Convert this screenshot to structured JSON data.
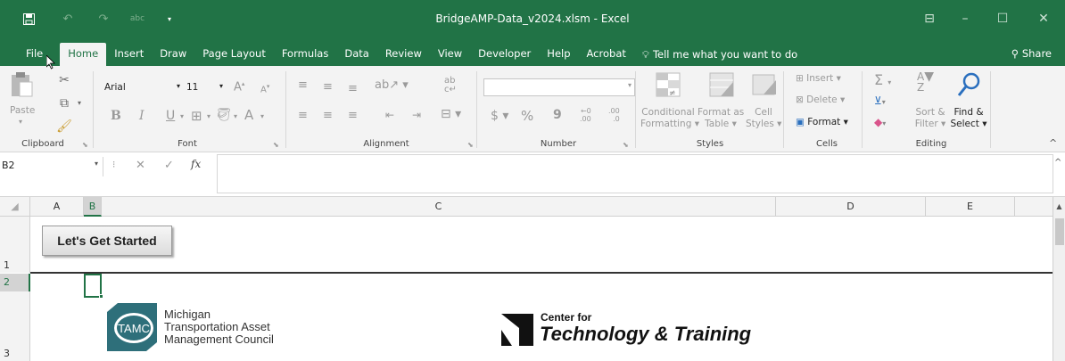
{
  "window": {
    "title": "BridgeAMP-Data_v2024.xlsm  -  Excel",
    "abc_label": "abc"
  },
  "tabs": [
    "File",
    "Home",
    "Insert",
    "Draw",
    "Page Layout",
    "Formulas",
    "Data",
    "Review",
    "View",
    "Developer",
    "Help",
    "Acrobat"
  ],
  "tell_me": "Tell me what you want to do",
  "share": "Share",
  "ribbon": {
    "clipboard": {
      "paste": "Paste",
      "label": "Clipboard"
    },
    "font": {
      "name": "Arial",
      "size": "11",
      "label": "Font",
      "bold": "B",
      "italic": "I",
      "underline": "U",
      "grow": "A",
      "shrink": "A",
      "color_a": "A"
    },
    "alignment": {
      "label": "Alignment"
    },
    "number": {
      "label": "Number",
      "currency": "$",
      "percent": "%",
      "comma": "9",
      "inc_dec": ".00",
      "dec_dec": ".0",
      "inc_dec_top": "←0",
      "dec_dec_top": ".00"
    },
    "styles": {
      "label": "Styles",
      "conditional": [
        "Conditional",
        "Formatting"
      ],
      "format_as": [
        "Format as",
        "Table"
      ],
      "cell_styles": [
        "Cell",
        "Styles"
      ]
    },
    "cells": {
      "label": "Cells",
      "insert": "Insert",
      "delete": "Delete",
      "format": "Format"
    },
    "editing": {
      "label": "Editing",
      "sort_filter": [
        "Sort &",
        "Filter"
      ],
      "find_select": [
        "Find &",
        "Select"
      ]
    }
  },
  "formula_bar": {
    "name_box": "B2",
    "fx": "fx",
    "value": ""
  },
  "columns": [
    "A",
    "B",
    "C",
    "D",
    "E"
  ],
  "rows": [
    "1",
    "2",
    "3"
  ],
  "sheet": {
    "button": "Let's Get Started",
    "tamc_mark": "TAMC",
    "tamc_lines": [
      "Michigan",
      "Transportation Asset",
      "Management Council"
    ],
    "ctt_top": "Center for",
    "ctt_main": "Technology & Training"
  },
  "colors": {
    "excel_green": "#217346",
    "ribbon_bg": "#f3f3f3",
    "tamc_teal": "#2e6f7a"
  }
}
